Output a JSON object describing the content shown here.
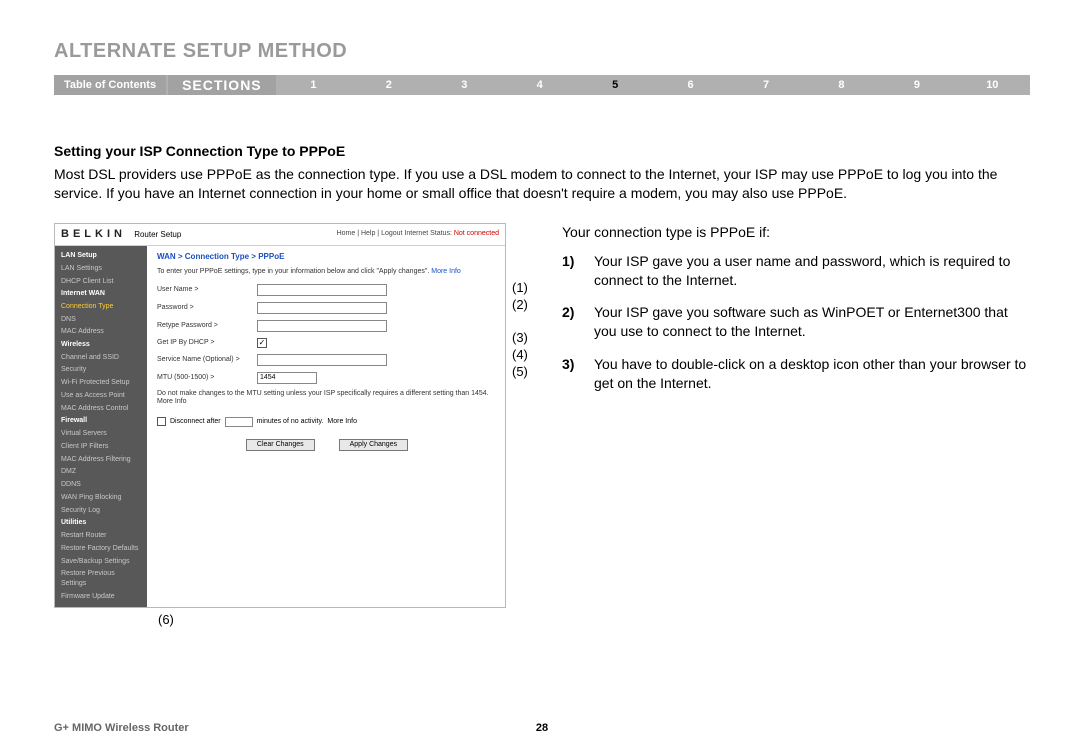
{
  "title": "ALTERNATE SETUP METHOD",
  "nav": {
    "toc": "Table of Contents",
    "sections_label": "SECTIONS",
    "items": [
      "1",
      "2",
      "3",
      "4",
      "5",
      "6",
      "7",
      "8",
      "9",
      "10"
    ],
    "active_index": 4
  },
  "subhead": "Setting your ISP Connection Type to PPPoE",
  "intro": "Most DSL providers use PPPoE as the connection type. If you use a DSL modem to connect to the Internet, your ISP may use PPPoE to log you into the service. If you have an Internet connection in your home or small office that doesn't require a modem, you may also use PPPoE.",
  "right": {
    "lead": "Your connection type is PPPoE if:",
    "conditions": [
      "Your ISP gave you a user name and password, which is required to connect to the Internet.",
      "Your ISP gave you software such as WinPOET or Enternet300 that you use to connect to the Internet.",
      "You have to double-click on a desktop icon other than your browser to get on the Internet."
    ]
  },
  "router": {
    "brand": "BELKIN",
    "brand_sub": "Router Setup",
    "head_links": "Home | Help | Logout   Internet Status:",
    "status": "Not connected",
    "nav_groups": [
      {
        "header": "LAN Setup",
        "items": [
          "LAN Settings",
          "DHCP Client List"
        ]
      },
      {
        "header": "Internet WAN",
        "items": [
          "Connection Type",
          "DNS",
          "MAC Address"
        ],
        "active": 0
      },
      {
        "header": "Wireless",
        "items": [
          "Channel and SSID",
          "Security",
          "Wi-Fi Protected Setup",
          "Use as Access Point",
          "MAC Address Control"
        ]
      },
      {
        "header": "Firewall",
        "items": [
          "Virtual Servers",
          "Client IP Filters",
          "MAC Address Filtering",
          "DMZ",
          "DDNS",
          "WAN Ping Blocking",
          "Security Log"
        ]
      },
      {
        "header": "Utilities",
        "items": [
          "Restart Router",
          "Restore Factory Defaults",
          "Save/Backup Settings",
          "Restore Previous Settings",
          "Firmware Update"
        ]
      }
    ],
    "crumbs": "WAN > Connection Type > PPPoE",
    "instr_pre": "To enter your PPPoE settings, type in your information below and click \"Apply changes\".",
    "more": "More Info",
    "fields": {
      "username_label": "User Name >",
      "password_label": "Password >",
      "retype_label": "Retype Password >",
      "dhcp_label": "Get IP By DHCP >",
      "service_label": "Service Name (Optional) >",
      "mtu_label": "MTU (500-1500) >",
      "mtu_value": "1454",
      "mtu_note_pre": "Do not make changes to the MTU setting unless your ISP specifically requires a different setting than 1454.",
      "disc_chk_label": "Disconnect after",
      "disc_suffix": "minutes of no activity.",
      "clear_btn": "Clear Changes",
      "apply_btn": "Apply Changes"
    }
  },
  "callouts": [
    "(1)",
    "(2)",
    "(3)",
    "(4)",
    "(5)"
  ],
  "callout6": "(6)",
  "footer": {
    "product": "G+ MIMO Wireless Router",
    "page": "28"
  }
}
